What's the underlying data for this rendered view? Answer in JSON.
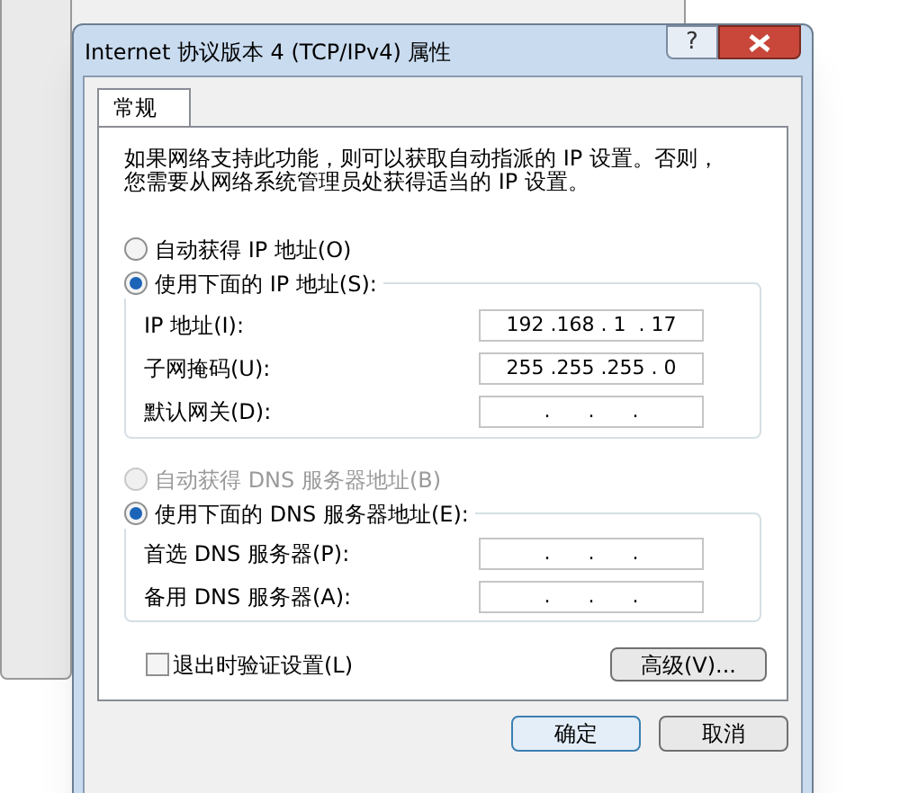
{
  "dialog": {
    "title": "Internet 协议版本 4 (TCP/IPv4) 属性",
    "help": "?"
  },
  "tabs": [
    {
      "label": "常规",
      "selected": true
    }
  ],
  "description": [
    "如果网络支持此功能，则可以获取自动指派的 IP 设置。否则，",
    "您需要从网络系统管理员处获得适当的 IP 设置。"
  ],
  "ip_mode": [
    {
      "label": "自动获得 IP 地址(O)",
      "selected": false,
      "disabled": false
    },
    {
      "label": "使用下面的 IP 地址(S):",
      "selected": true,
      "disabled": false
    }
  ],
  "ip_fields": [
    {
      "label": "IP 地址(I):",
      "value": "192 .168 . 1  . 17"
    },
    {
      "label": "子网掩码(U):",
      "value": "255 .255 .255 . 0"
    },
    {
      "label": "默认网关(D):",
      "value": ".      .      ."
    }
  ],
  "dns_mode": [
    {
      "label": "自动获得 DNS 服务器地址(B)",
      "selected": false,
      "disabled": true
    },
    {
      "label": "使用下面的 DNS 服务器地址(E):",
      "selected": true,
      "disabled": false
    }
  ],
  "dns_fields": [
    {
      "label": "首选 DNS 服务器(P):",
      "value": ".      .      ."
    },
    {
      "label": "备用 DNS 服务器(A):",
      "value": ".      .      ."
    }
  ],
  "validate": {
    "label": "退出时验证设置(L)",
    "checked": false
  },
  "advanced_button": "高级(V)...",
  "buttons": [
    {
      "label": "确定",
      "default": true
    },
    {
      "label": "取消",
      "default": false
    }
  ]
}
